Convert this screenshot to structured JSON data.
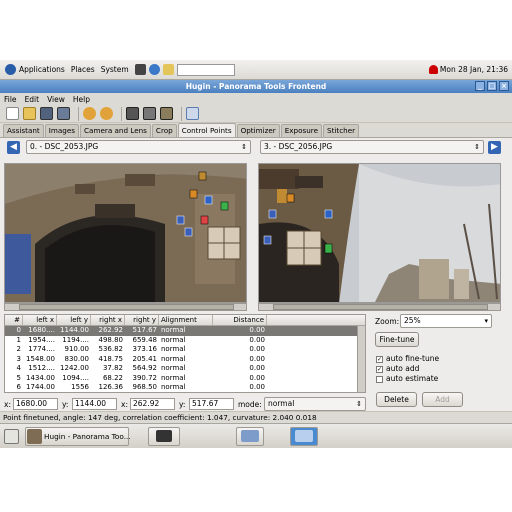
{
  "gnome_panel": {
    "menus": [
      "Applications",
      "Places",
      "System"
    ],
    "clock": "Mon 28 Jan, 21:36"
  },
  "window": {
    "title": "Hugin - Panorama Tools Frontend",
    "menu": [
      "File",
      "Edit",
      "View",
      "Help"
    ]
  },
  "toolbar_icons": [
    "new-icon",
    "open-icon",
    "save-icon",
    "save-as-icon",
    "undo-icon",
    "redo-icon",
    "optimize-icon",
    "preview-icon",
    "stitch-icon",
    "help-icon"
  ],
  "tabs": [
    "Assistant",
    "Images",
    "Camera and Lens",
    "Crop",
    "Control Points",
    "Optimizer",
    "Exposure",
    "Stitcher"
  ],
  "active_tab": "Control Points",
  "left_image": {
    "selected": "0. - DSC_2053.JPG"
  },
  "right_image": {
    "selected": "3. - DSC_2056.JPG"
  },
  "table": {
    "columns": [
      "#",
      "left x",
      "left y",
      "right x",
      "right y",
      "Alignment",
      "Distance"
    ],
    "rows": [
      [
        "0",
        "1680....",
        "1144.00",
        "262.92",
        "517.67",
        "normal",
        "0.00"
      ],
      [
        "1",
        "1954....",
        "1194....",
        "498.80",
        "659.48",
        "normal",
        "0.00"
      ],
      [
        "2",
        "1774....",
        "910.00",
        "536.82",
        "373.16",
        "normal",
        "0.00"
      ],
      [
        "3",
        "1548.00",
        "830.00",
        "418.75",
        "205.41",
        "normal",
        "0.00"
      ],
      [
        "4",
        "1512....",
        "1242.00",
        "37.82",
        "564.92",
        "normal",
        "0.00"
      ],
      [
        "5",
        "1434.00",
        "1094....",
        "68.22",
        "390.72",
        "normal",
        "0.00"
      ],
      [
        "6",
        "1744.00",
        "1556",
        "126.36",
        "968.50",
        "normal",
        "0.00"
      ]
    ],
    "selected_row": 0
  },
  "right_panel": {
    "zoom_label": "Zoom:",
    "zoom_value": "25%",
    "finetune_button": "Fine-tune",
    "auto_finetune": "auto fine-tune",
    "auto_add": "auto add",
    "auto_estimate": "auto estimate",
    "delete_button": "Delete",
    "add_button": "Add"
  },
  "coords": {
    "x1_label": "x:",
    "x1": "1680.00",
    "y1_label": "y:",
    "y1": "1144.00",
    "x2_label": "x:",
    "x2": "262.92",
    "y2_label": "y:",
    "y2": "517.67",
    "mode_label": "mode:",
    "mode": "normal"
  },
  "status": "Point finetuned, angle: 147 deg, correlation coefficient: 1.047, curvature: 2.040 0.018",
  "taskbar": {
    "tasks": [
      "Hugin - Panorama Too..."
    ]
  },
  "colors": {
    "titlebar": "#4a7fc0",
    "selected_row": "#7a7875",
    "nav_arrow": "#3466b4"
  }
}
